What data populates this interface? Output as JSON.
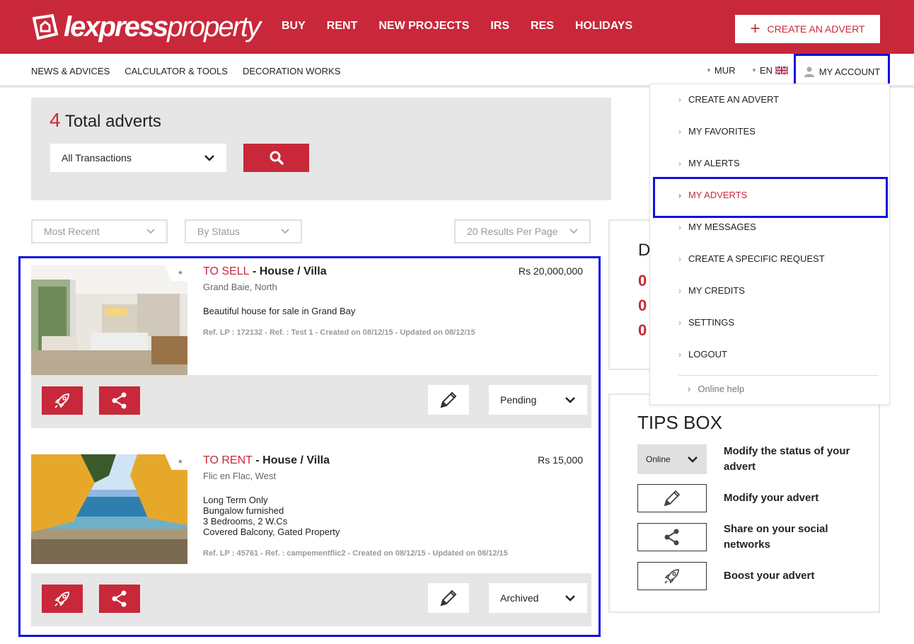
{
  "header": {
    "logo_bold": "lexpress",
    "logo_light": "property",
    "nav": [
      "BUY",
      "RENT",
      "NEW PROJECTS",
      "IRS",
      "RES",
      "HOLIDAYS"
    ],
    "create_label": "CREATE AN ADVERT",
    "brand_color": "#c8283a"
  },
  "subnav": {
    "links": [
      "NEWS & ADVICES",
      "CALCULATOR & TOOLS",
      "DECORATION WORKS"
    ],
    "currency": "MUR",
    "language": "EN",
    "account": "MY ACCOUNT"
  },
  "search": {
    "total_count": "4",
    "total_label": "Total adverts",
    "transaction": "All Transactions"
  },
  "filters": {
    "sort": "Most Recent",
    "status": "By Status",
    "per_page": "20 Results Per Page"
  },
  "adverts": [
    {
      "transaction": "TO SELL",
      "type": " - House / Villa",
      "price": "Rs 20,000,000",
      "location": "Grand Baie, North",
      "description": [
        "Beautiful house for sale in Grand Bay"
      ],
      "ref": "Ref. LP : 172132 - Ref. : Test 1 - Created on 08/12/15 - Updated on 08/12/15",
      "status": "Pending",
      "image": "interior-icon"
    },
    {
      "transaction": "TO RENT",
      "type": " - House / Villa",
      "price": "Rs 15,000",
      "location": "Flic en Flac, West",
      "description": [
        "Long Term Only",
        "Bungalow furnished",
        "3 Bedrooms, 2 W.Cs",
        "Covered Balcony, Gated Property"
      ],
      "ref": "Ref. LP : 45761 - Ref. : campementflic2 - Created on 08/12/15 - Updated on 08/12/15",
      "status": "Archived",
      "image": "beach-icon"
    }
  ],
  "side_card": {
    "letter": "D",
    "values": [
      "0",
      "0",
      "0"
    ]
  },
  "account_menu": {
    "items": [
      "CREATE AN ADVERT",
      "MY FAVORITES",
      "MY ALERTS",
      "MY ADVERTS",
      "MY MESSAGES",
      "CREATE A SPECIFIC REQUEST",
      "MY CREDITS",
      "SETTINGS",
      "LOGOUT"
    ],
    "active": "MY ADVERTS",
    "help": "Online help"
  },
  "tips": {
    "title": "TIPS BOX",
    "status_example": "Online",
    "items": [
      {
        "text": "Modify the status of your advert",
        "icon": "status-dropdown"
      },
      {
        "text": "Modify your advert",
        "icon": "pencil-icon"
      },
      {
        "text": "Share on your social networks",
        "icon": "share-icon"
      },
      {
        "text": "Boost your advert",
        "icon": "rocket-icon"
      }
    ]
  }
}
